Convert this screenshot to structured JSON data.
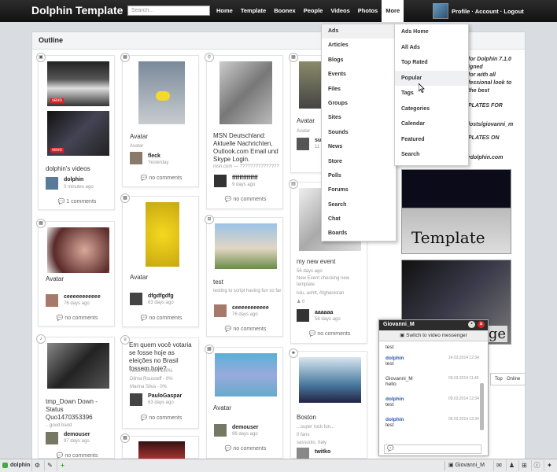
{
  "app": {
    "brand": "Dolphin Template",
    "search_placeholder": "Search..."
  },
  "nav": [
    "Home",
    "Template",
    "Boonex",
    "People",
    "Videos",
    "Photos",
    "More"
  ],
  "user_menu": "Profile · Account · Logout",
  "page_title": "Outline",
  "cards": {
    "c1": {
      "title": "dolphin's videos",
      "user": "dolphin",
      "time": "0 minutes ago",
      "comments": "1 comments",
      "thumb_label": "vevo"
    },
    "c2": {
      "title": "Avatar",
      "sub": "Avatar",
      "user": "fleck",
      "time": "Yesterday",
      "comments": "no comments"
    },
    "c3": {
      "title": "MSN Deutschland: Aktuelle Nachrichten, Outlook.com Email und Skype Login.",
      "sub": "msn.com — ???????????????",
      "user": "ffffffffffffff",
      "time": "9 days ago",
      "comments": "no comments"
    },
    "c4": {
      "title": "Avatar",
      "sub": "Avatar",
      "user": "su",
      "time": "11",
      "comments": ""
    },
    "c5": {
      "title": "Avatar",
      "user": "ceeeeeeeeeee",
      "time": "76 days ago",
      "comments": "no comments"
    },
    "c6": {
      "title": "Avatar",
      "user": "dfgdfgdfg",
      "time": "63 days ago",
      "comments": "no comments"
    },
    "c7": {
      "title": "test",
      "sub": "testing to script having fun so far",
      "user": "ceeeeeeeeeee",
      "time": "76 days ago",
      "comments": "no comments"
    },
    "c8": {
      "title": "my new event",
      "sub1": "56 days ago",
      "sub2": "New Event checking new template",
      "sub3": "lulu, ashtt, Afghanistan",
      "count": "0",
      "user": "aaaaaa",
      "time": "56 days ago",
      "comments": "no comments"
    },
    "c9": {
      "title": "tmp_Down Down - Status Quo1470353396",
      "sub": "...good band",
      "user": "demouser",
      "time": "97 days ago",
      "comments": "no comments"
    },
    "c10": {
      "title": "Em quem você votaria se fosse hoje as eleições no Brasil fossem hoje?",
      "opt1": "Aécio Neves - 100%",
      "opt2": "Dilma Rousseff - 0%",
      "opt3": "Marina Silva - 0%",
      "user": "PauloGaspar",
      "time": "63 days ago",
      "comments": "no comments"
    },
    "c11": {
      "title": "Avatar",
      "user": "demouser",
      "time": "96 days ago",
      "comments": "no comments"
    },
    "c12": {
      "title": "Boston",
      "sub1": "...super rock fun...",
      "sub2": "0 fans",
      "sub3": "sassuolo, Italy",
      "user": "twitko"
    }
  },
  "more_menu": [
    "Ads",
    "Articles",
    "Blogs",
    "Events",
    "Files",
    "Groups",
    "Sites",
    "Sounds",
    "News",
    "Store",
    "Polls",
    "Forums",
    "Search",
    "Chat",
    "Boards"
  ],
  "ads_submenu": [
    "Ads Home",
    "All Ads",
    "Top Rated",
    "Popular",
    "Tags",
    "Categories",
    "Calendar",
    "Featured",
    "Search"
  ],
  "right_panel": {
    "lines": [
      "for Dolphin 7.1.0",
      "igned",
      "for with all",
      "fessional look to",
      "the best",
      "PLATES FOR",
      "losts/giovanni_m",
      "PLATES ON",
      "rdolphin.com"
    ],
    "banner1_text": "Template",
    "banner2_text": "ge",
    "tab_labels": [
      "Top",
      "Online"
    ]
  },
  "chat": {
    "title": "Giovanni_M",
    "switch_label": "Switch to video messenger",
    "messages": [
      {
        "name": "dolphin",
        "text": "test",
        "time": "14.03.2014 12:34"
      },
      {
        "name": "Giovanni_M",
        "text": "hello",
        "time": "09.03.2014 11:40"
      },
      {
        "name": "dolphin",
        "text": "test",
        "time": "09.03.2014 12:34"
      },
      {
        "name": "dolphin",
        "text": "test",
        "time": "09.03.2014 12:34"
      }
    ],
    "first_line": "test"
  },
  "bottombar": {
    "user": "dolphin",
    "chat_tab": "Giovanni_M"
  }
}
